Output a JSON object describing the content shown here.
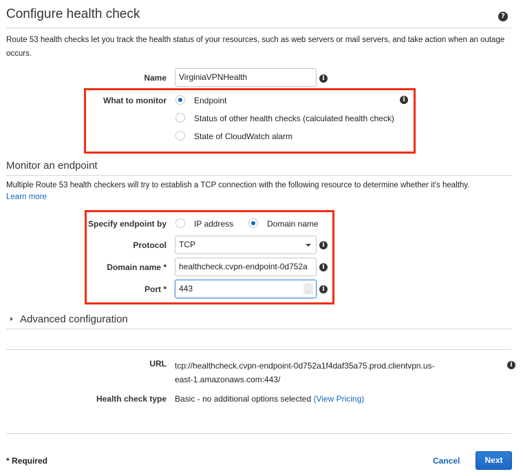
{
  "header": {
    "title": "Configure health check",
    "help_icon": "question-circle-icon",
    "description": "Route 53 health checks let you track the health status of your resources, such as web servers or mail servers, and take action when an outage occurs."
  },
  "form": {
    "name": {
      "label": "Name",
      "value": "VirginiaVPNHealth"
    },
    "what_to_monitor": {
      "label": "What to monitor",
      "options": [
        {
          "label": "Endpoint",
          "selected": true
        },
        {
          "label": "Status of other health checks (calculated health check)",
          "selected": false
        },
        {
          "label": "State of CloudWatch alarm",
          "selected": false
        }
      ]
    }
  },
  "monitor_endpoint": {
    "title": "Monitor an endpoint",
    "description": "Multiple Route 53 health checkers will try to establish a TCP connection with the following resource to determine whether it's healthy.",
    "learn_more": "Learn more",
    "specify_by": {
      "label": "Specify endpoint by",
      "options": [
        {
          "label": "IP address",
          "selected": false
        },
        {
          "label": "Domain name",
          "selected": true
        }
      ]
    },
    "protocol": {
      "label": "Protocol",
      "value": "TCP"
    },
    "domain_name": {
      "label": "Domain name *",
      "value": "healthcheck.cvpn-endpoint-0d752a"
    },
    "port": {
      "label": "Port *",
      "value": "443"
    }
  },
  "advanced": {
    "label": "Advanced configuration",
    "expanded": false
  },
  "summary": {
    "url_label": "URL",
    "url_line1": "tcp://healthcheck.cvpn-endpoint-0d752a1f4daf35a75.prod.clientvpn.us-",
    "url_line2": "east-1.amazonaws.com:443/",
    "type_label": "Health check type",
    "type_value": "Basic - no additional options selected",
    "pricing_link": "(View Pricing)"
  },
  "footer": {
    "required_note": "* Required",
    "cancel": "Cancel",
    "next": "Next"
  },
  "colors": {
    "accent": "#1a66c6",
    "highlight_box": "#f12d12",
    "link": "#1166bb"
  }
}
